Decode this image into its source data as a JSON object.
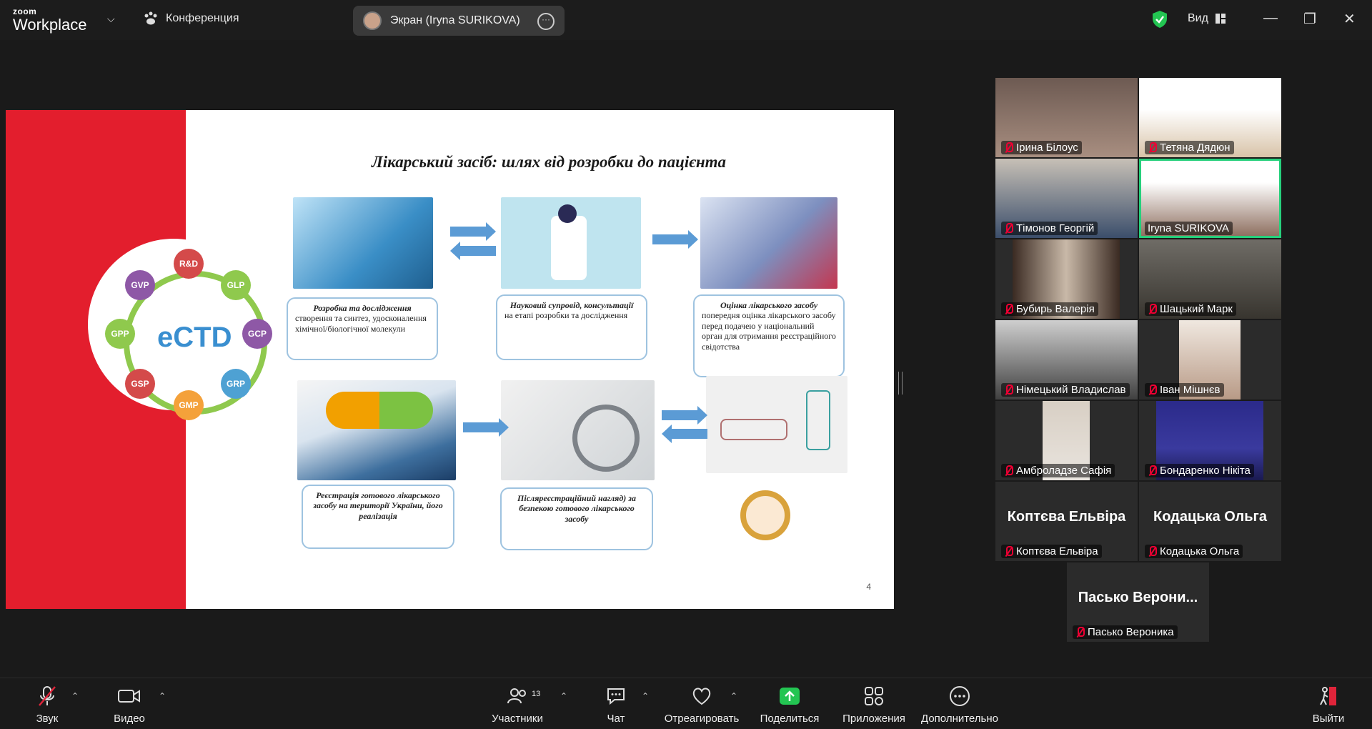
{
  "topbar": {
    "logo_top": "zoom",
    "logo_bottom": "Workplace",
    "conference": "Конференция",
    "screen_share": "Экран (Iryna SURIKOVA)",
    "view": "Вид"
  },
  "slide": {
    "title": "Лікарський засіб: шлях від розробки до пацієнта",
    "center_logo": "eCTD",
    "bubbles": [
      "R&D",
      "GLP",
      "GCP",
      "GRP",
      "GMP",
      "GSP",
      "GPP",
      "GVP"
    ],
    "boxes": {
      "b1_title": "Розробка та дослідження",
      "b1_text": "створення та синтез, удосконалення хімічної/біологічної молекули",
      "b2_title": "Науковий супровід, консультації",
      "b2_text": "на етапі розробки та дослідження",
      "b3_title": "Оцінка лікарського засобу",
      "b3_text": "попередня оцінка лікарського засобу перед подачею у національний орган для отримання реєстраційного свідотства",
      "b4_text": "Реєстрація готового лікарського засобу на території України, його реалізація",
      "b5_text": "Післяреєстраційний нагляд) за безпекою готового лікарського засобу"
    },
    "page_number": "4"
  },
  "participants": [
    {
      "name": "Ірина Білоус",
      "video": true
    },
    {
      "name": "Тетяна Дядюн",
      "video": true
    },
    {
      "name": "Тімонов Георгій",
      "video": true
    },
    {
      "name": "Iryna SURIKOVA",
      "video": true,
      "active": true
    },
    {
      "name": "Бубирь Валерія",
      "video": true
    },
    {
      "name": "Шацький Марк",
      "video": true
    },
    {
      "name": "Німецький Владислав",
      "video": true
    },
    {
      "name": "Іван Мішнєв",
      "video": true
    },
    {
      "name": "Амброладзе Сафія",
      "video": true
    },
    {
      "name": "Бондаренко Нікіта",
      "video": true
    },
    {
      "name": "Коптєва Ельвіра",
      "big": "Коптєва Ельвіра",
      "video": false
    },
    {
      "name": "Кодацька Ольга",
      "big": "Кодацька Ольга",
      "video": false
    },
    {
      "name": "Пасько Вероника",
      "big": "Пасько Верони...",
      "video": false
    }
  ],
  "toolbar": {
    "audio": "Звук",
    "video": "Видео",
    "participants": "Участники",
    "participants_count": "13",
    "chat": "Чат",
    "react": "Отреагировать",
    "share": "Поделиться",
    "apps": "Приложения",
    "more": "Дополнительно",
    "leave": "Выйти"
  },
  "colors": {
    "accent": "#26d07c",
    "share_green": "#23c552",
    "mute_red": "#e0243a",
    "slide_red": "#e31e2d"
  }
}
